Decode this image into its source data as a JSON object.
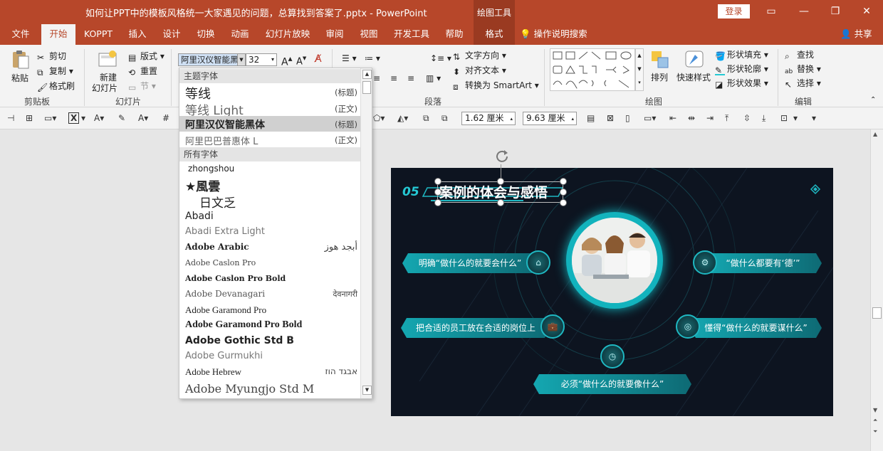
{
  "window": {
    "title": "如何让PPT中的模板风格统一大家遇见的问题，总算找到答案了.pptx - PowerPoint",
    "context_label": "绘图工具",
    "login_label": "登录",
    "controls": [
      "restore-ribbon",
      "minimize",
      "maximize",
      "close"
    ]
  },
  "tabs": [
    "文件",
    "开始",
    "KOPPT",
    "插入",
    "设计",
    "切换",
    "动画",
    "幻灯片放映",
    "审阅",
    "视图",
    "开发工具",
    "帮助",
    "格式"
  ],
  "active_tab": "开始",
  "tell_me": "操作说明搜索",
  "share": "共享",
  "ribbon": {
    "clipboard": {
      "paste": "粘贴",
      "cut": "剪切",
      "copy": "复制",
      "format_painter": "格式刷",
      "label": "剪贴板"
    },
    "slides": {
      "new_slide_line1": "新建",
      "new_slide_line2": "幻灯片",
      "layout": "版式",
      "reset": "重置",
      "section": "节",
      "label": "幻灯片"
    },
    "font": {
      "name": "阿里汉仪智能黑",
      "size": "32"
    },
    "paragraph": {
      "text_direction": "文字方向",
      "align_text": "对齐文本",
      "smartart": "转换为 SmartArt",
      "label": "段落"
    },
    "drawing": {
      "arrange": "排列",
      "quick_styles": "快速样式",
      "shape_fill": "形状填充",
      "shape_outline": "形状轮廓",
      "shape_effects": "形状效果",
      "label": "绘图"
    },
    "editing": {
      "find": "查找",
      "replace": "替换",
      "select": "选择",
      "label": "编辑"
    }
  },
  "toolbar2": {
    "height_value": "1.62 厘米",
    "width_value": "9.63 厘米"
  },
  "font_dropdown": {
    "theme_header": "主题字体",
    "all_header": "所有字体",
    "theme_fonts": [
      {
        "name": "等线",
        "tag": "(标题)"
      },
      {
        "name": "等线 Light",
        "tag": "(正文)"
      },
      {
        "name": "阿里汉仪智能黑体",
        "tag": "(标题)"
      },
      {
        "name": "阿里巴巴普惠体 L",
        "tag": "(正文)"
      }
    ],
    "all_fonts": [
      {
        "name": "zhongshou",
        "tag": ""
      },
      {
        "name": "★風雲",
        "tag": ""
      },
      {
        "name": "日文乏",
        "tag": ""
      },
      {
        "name": "Abadi",
        "tag": ""
      },
      {
        "name": "Abadi Extra Light",
        "tag": ""
      },
      {
        "name": "Adobe Arabic",
        "tag": "أبجد هوز"
      },
      {
        "name": "Adobe Caslon Pro",
        "tag": ""
      },
      {
        "name": "Adobe Caslon Pro Bold",
        "tag": ""
      },
      {
        "name": "Adobe Devanagari",
        "tag": "देवनागरी"
      },
      {
        "name": "Adobe Garamond Pro",
        "tag": ""
      },
      {
        "name": "Adobe Garamond Pro Bold",
        "tag": ""
      },
      {
        "name": "Adobe Gothic Std B",
        "tag": ""
      },
      {
        "name": "Adobe Gurmukhi",
        "tag": ""
      },
      {
        "name": "Adobe Hebrew",
        "tag": "אבגד הוז"
      },
      {
        "name": "Adobe Myungjo Std M",
        "tag": ""
      }
    ]
  },
  "slide": {
    "number": "05",
    "title": "案例的体会与感悟",
    "pills": [
      "明确“做什么的就要会什么”",
      "“做什么都要有‘德’”",
      "把合适的员工放在合适的岗位上",
      "懂得“做什么的就要谋什么”",
      "必须“做什么的就要像什么”"
    ],
    "accent_color": "#1fb8c2",
    "background_color": "#0d1420"
  }
}
